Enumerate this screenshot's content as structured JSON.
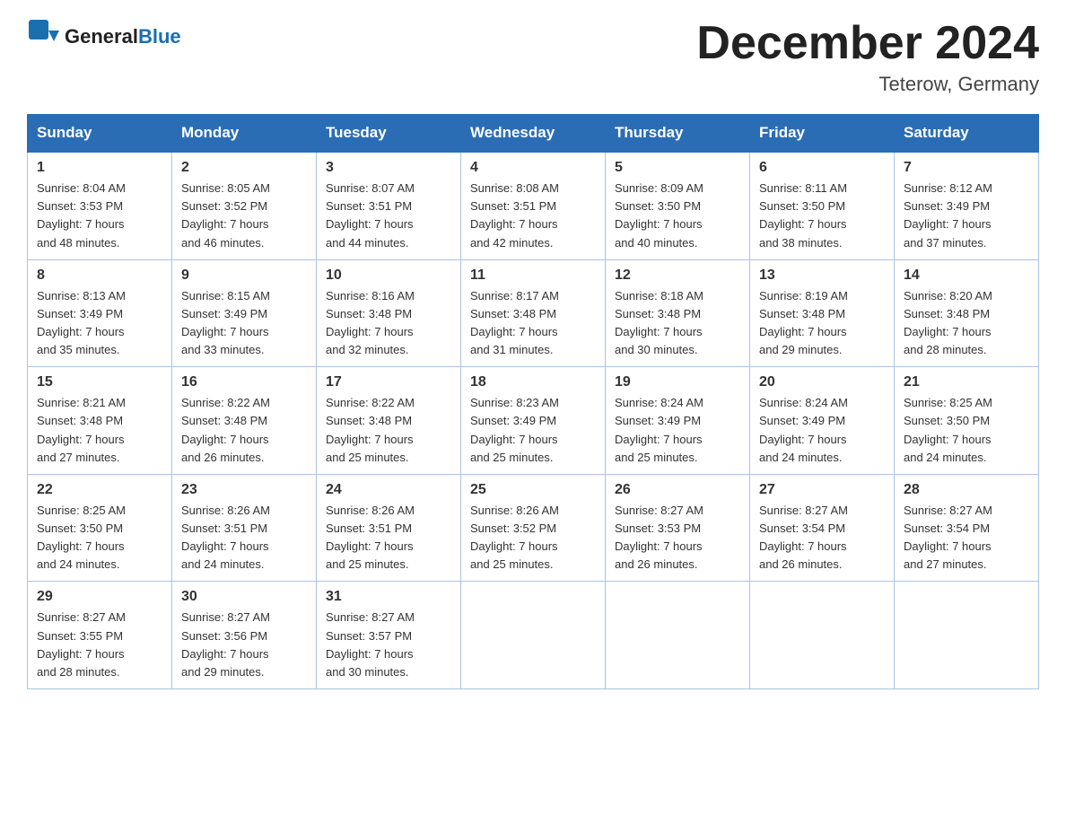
{
  "header": {
    "logo_general": "General",
    "logo_blue": "Blue",
    "month_title": "December 2024",
    "location": "Teterow, Germany"
  },
  "days_of_week": [
    "Sunday",
    "Monday",
    "Tuesday",
    "Wednesday",
    "Thursday",
    "Friday",
    "Saturday"
  ],
  "weeks": [
    [
      {
        "day": "1",
        "sunrise": "8:04 AM",
        "sunset": "3:53 PM",
        "daylight": "7 hours and 48 minutes."
      },
      {
        "day": "2",
        "sunrise": "8:05 AM",
        "sunset": "3:52 PM",
        "daylight": "7 hours and 46 minutes."
      },
      {
        "day": "3",
        "sunrise": "8:07 AM",
        "sunset": "3:51 PM",
        "daylight": "7 hours and 44 minutes."
      },
      {
        "day": "4",
        "sunrise": "8:08 AM",
        "sunset": "3:51 PM",
        "daylight": "7 hours and 42 minutes."
      },
      {
        "day": "5",
        "sunrise": "8:09 AM",
        "sunset": "3:50 PM",
        "daylight": "7 hours and 40 minutes."
      },
      {
        "day": "6",
        "sunrise": "8:11 AM",
        "sunset": "3:50 PM",
        "daylight": "7 hours and 38 minutes."
      },
      {
        "day": "7",
        "sunrise": "8:12 AM",
        "sunset": "3:49 PM",
        "daylight": "7 hours and 37 minutes."
      }
    ],
    [
      {
        "day": "8",
        "sunrise": "8:13 AM",
        "sunset": "3:49 PM",
        "daylight": "7 hours and 35 minutes."
      },
      {
        "day": "9",
        "sunrise": "8:15 AM",
        "sunset": "3:49 PM",
        "daylight": "7 hours and 33 minutes."
      },
      {
        "day": "10",
        "sunrise": "8:16 AM",
        "sunset": "3:48 PM",
        "daylight": "7 hours and 32 minutes."
      },
      {
        "day": "11",
        "sunrise": "8:17 AM",
        "sunset": "3:48 PM",
        "daylight": "7 hours and 31 minutes."
      },
      {
        "day": "12",
        "sunrise": "8:18 AM",
        "sunset": "3:48 PM",
        "daylight": "7 hours and 30 minutes."
      },
      {
        "day": "13",
        "sunrise": "8:19 AM",
        "sunset": "3:48 PM",
        "daylight": "7 hours and 29 minutes."
      },
      {
        "day": "14",
        "sunrise": "8:20 AM",
        "sunset": "3:48 PM",
        "daylight": "7 hours and 28 minutes."
      }
    ],
    [
      {
        "day": "15",
        "sunrise": "8:21 AM",
        "sunset": "3:48 PM",
        "daylight": "7 hours and 27 minutes."
      },
      {
        "day": "16",
        "sunrise": "8:22 AM",
        "sunset": "3:48 PM",
        "daylight": "7 hours and 26 minutes."
      },
      {
        "day": "17",
        "sunrise": "8:22 AM",
        "sunset": "3:48 PM",
        "daylight": "7 hours and 25 minutes."
      },
      {
        "day": "18",
        "sunrise": "8:23 AM",
        "sunset": "3:49 PM",
        "daylight": "7 hours and 25 minutes."
      },
      {
        "day": "19",
        "sunrise": "8:24 AM",
        "sunset": "3:49 PM",
        "daylight": "7 hours and 25 minutes."
      },
      {
        "day": "20",
        "sunrise": "8:24 AM",
        "sunset": "3:49 PM",
        "daylight": "7 hours and 24 minutes."
      },
      {
        "day": "21",
        "sunrise": "8:25 AM",
        "sunset": "3:50 PM",
        "daylight": "7 hours and 24 minutes."
      }
    ],
    [
      {
        "day": "22",
        "sunrise": "8:25 AM",
        "sunset": "3:50 PM",
        "daylight": "7 hours and 24 minutes."
      },
      {
        "day": "23",
        "sunrise": "8:26 AM",
        "sunset": "3:51 PM",
        "daylight": "7 hours and 24 minutes."
      },
      {
        "day": "24",
        "sunrise": "8:26 AM",
        "sunset": "3:51 PM",
        "daylight": "7 hours and 25 minutes."
      },
      {
        "day": "25",
        "sunrise": "8:26 AM",
        "sunset": "3:52 PM",
        "daylight": "7 hours and 25 minutes."
      },
      {
        "day": "26",
        "sunrise": "8:27 AM",
        "sunset": "3:53 PM",
        "daylight": "7 hours and 26 minutes."
      },
      {
        "day": "27",
        "sunrise": "8:27 AM",
        "sunset": "3:54 PM",
        "daylight": "7 hours and 26 minutes."
      },
      {
        "day": "28",
        "sunrise": "8:27 AM",
        "sunset": "3:54 PM",
        "daylight": "7 hours and 27 minutes."
      }
    ],
    [
      {
        "day": "29",
        "sunrise": "8:27 AM",
        "sunset": "3:55 PM",
        "daylight": "7 hours and 28 minutes."
      },
      {
        "day": "30",
        "sunrise": "8:27 AM",
        "sunset": "3:56 PM",
        "daylight": "7 hours and 29 minutes."
      },
      {
        "day": "31",
        "sunrise": "8:27 AM",
        "sunset": "3:57 PM",
        "daylight": "7 hours and 30 minutes."
      },
      null,
      null,
      null,
      null
    ]
  ],
  "labels": {
    "sunrise": "Sunrise:",
    "sunset": "Sunset:",
    "daylight": "Daylight:"
  }
}
